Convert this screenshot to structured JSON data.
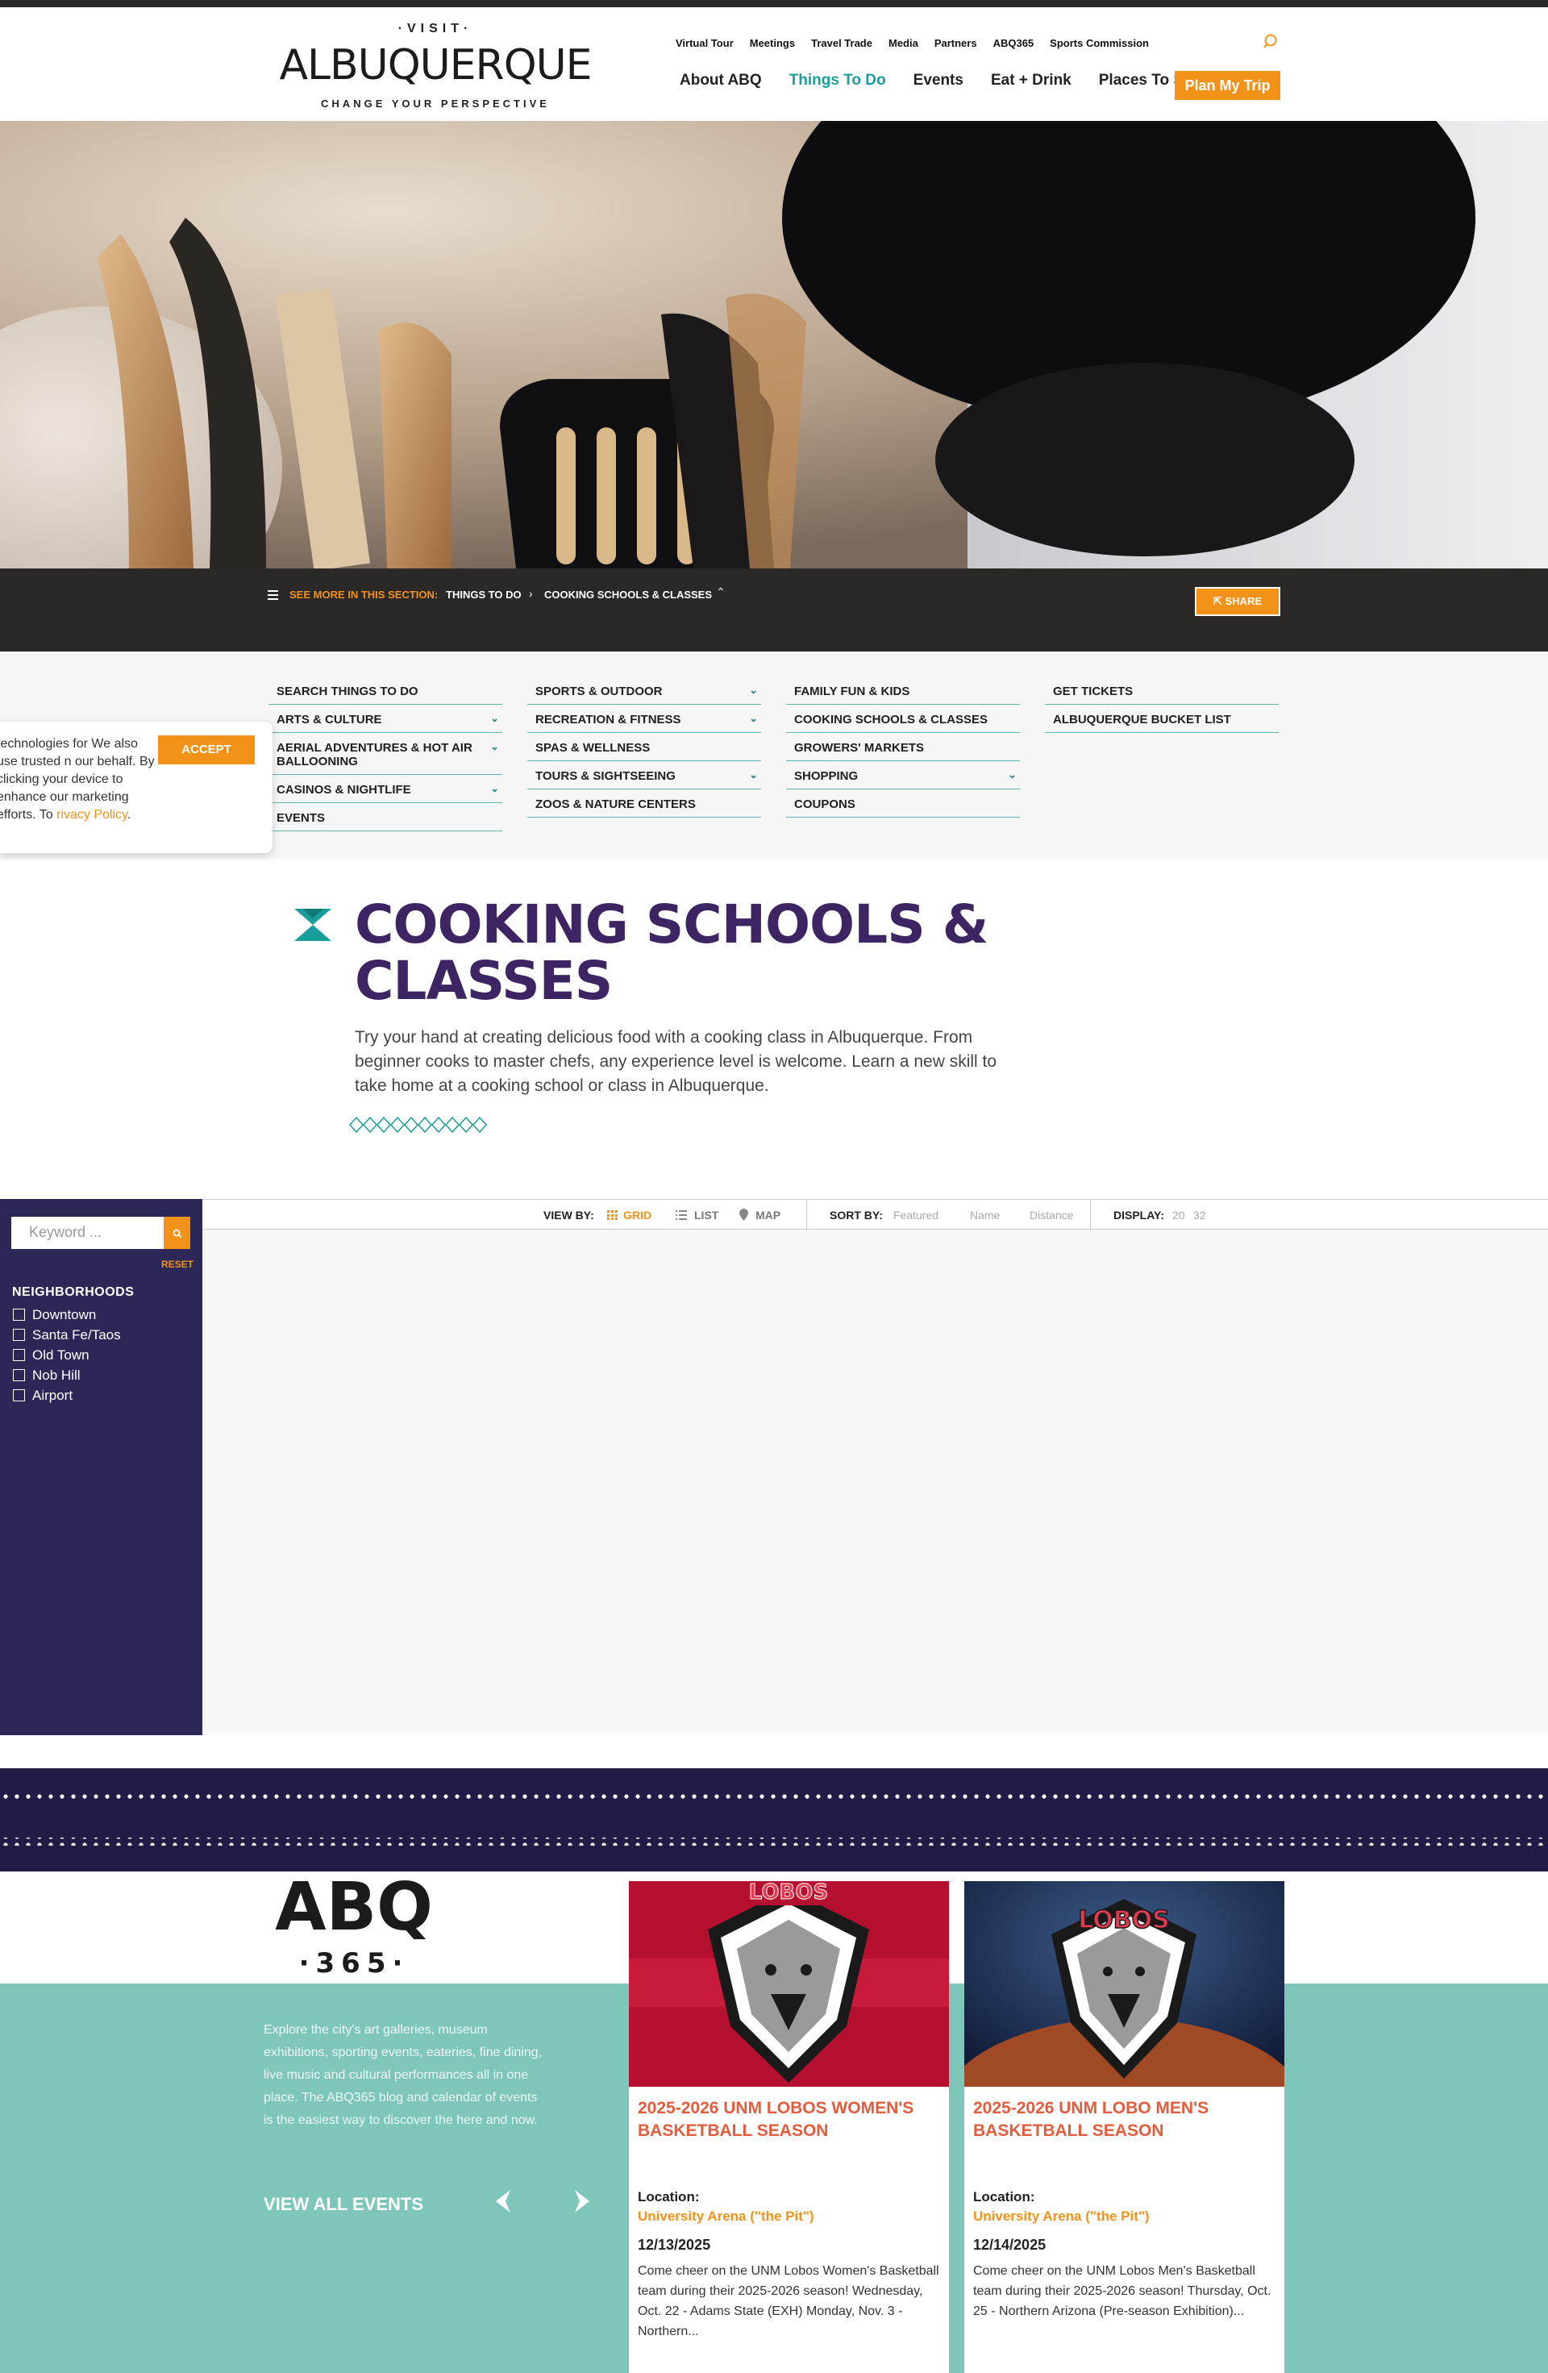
{
  "header": {
    "logo": {
      "visit": "·VISIT·",
      "wordmark": "ALBUQUERQUE",
      "tagline": "CHANGE YOUR PERSPECTIVE"
    },
    "utility_nav": [
      "Virtual Tour",
      "Meetings",
      "Travel Trade",
      "Media",
      "Partners",
      "ABQ365",
      "Sports Commission"
    ],
    "main_nav": [
      "About ABQ",
      "Things To Do",
      "Events",
      "Eat + Drink",
      "Places To Stay"
    ],
    "active_nav": "Things To Do",
    "plan_button": "Plan My Trip"
  },
  "section_bar": {
    "see_more": "SEE MORE IN THIS SECTION:",
    "crumb_parent": "THINGS TO DO",
    "crumb_current": "COOKING SCHOOLS & CLASSES",
    "share": "SHARE"
  },
  "subnav": {
    "col1": [
      {
        "label": "SEARCH THINGS TO DO",
        "expand": false
      },
      {
        "label": "ARTS & CULTURE",
        "expand": true
      },
      {
        "label": "AERIAL ADVENTURES & HOT AIR BALLOONING",
        "expand": true
      },
      {
        "label": "CASINOS & NIGHTLIFE",
        "expand": true
      },
      {
        "label": "EVENTS",
        "expand": false
      }
    ],
    "col2": [
      {
        "label": "SPORTS & OUTDOOR",
        "expand": true
      },
      {
        "label": "RECREATION & FITNESS",
        "expand": true
      },
      {
        "label": "SPAS & WELLNESS",
        "expand": false
      },
      {
        "label": "TOURS & SIGHTSEEING",
        "expand": true
      },
      {
        "label": "ZOOS & NATURE CENTERS",
        "expand": false
      }
    ],
    "col3": [
      {
        "label": "FAMILY FUN & KIDS",
        "expand": false
      },
      {
        "label": "COOKING SCHOOLS & CLASSES",
        "expand": false
      },
      {
        "label": "GROWERS' MARKETS",
        "expand": false
      },
      {
        "label": "SHOPPING",
        "expand": true
      },
      {
        "label": "COUPONS",
        "expand": false
      }
    ],
    "col4": [
      {
        "label": "GET TICKETS",
        "expand": false
      },
      {
        "label": "ALBUQUERQUE BUCKET LIST",
        "expand": false
      }
    ]
  },
  "cookie": {
    "text": "technologies for We also use trusted n our behalf. By clicking your device to enhance our marketing efforts. To",
    "link": "rivacy Policy",
    "after_link": ".",
    "accept": "ACCEPT"
  },
  "page": {
    "title": "COOKING SCHOOLS & CLASSES",
    "intro": "Try your hand at creating delicious food with a cooking class in Albuquerque. From beginner cooks to master chefs, any experience level is welcome. Learn a new skill to take home at a cooking school or class in Albuquerque."
  },
  "filters": {
    "keyword_placeholder": "Keyword ...",
    "reset": "RESET",
    "neighborhoods_title": "NEIGHBORHOODS",
    "neighborhoods": [
      "Downtown",
      "Santa Fe/Taos",
      "Old Town",
      "Nob Hill",
      "Airport"
    ]
  },
  "toolbar": {
    "view_by": "VIEW BY:",
    "grid": "GRID",
    "list": "LIST",
    "map": "MAP",
    "sort_by": "SORT BY:",
    "sort_featured": "Featured",
    "sort_name": "Name",
    "sort_distance": "Distance",
    "display": "DISPLAY:",
    "display_20": "20",
    "display_32": "32"
  },
  "abq365": {
    "logo_top": "ABQ",
    "logo_bottom": "·365·",
    "description": "Explore the city's art galleries, museum exhibitions, sporting events, eateries, fine dining, live music and cultural performances all in one place. The ABQ365 blog and calendar of events is the easiest way to discover the here and now.",
    "view_all": "VIEW ALL EVENTS",
    "cards": [
      {
        "image_text": "LOBOS",
        "title": "2025-2026 UNM LOBOS WOMEN'S BASKETBALL SEASON",
        "location_label": "Location:",
        "location": "University Arena (\"the Pit\")",
        "date": "12/13/2025",
        "description": "Come cheer on the UNM Lobos Women's Basketball team during their 2025-2026 season! Wednesday, Oct. 22 - Adams State (EXH) Monday, Nov. 3 - Northern..."
      },
      {
        "image_text": "LOBOS",
        "title": "2025-2026 UNM LOBO MEN'S BASKETBALL SEASON",
        "location_label": "Location:",
        "location": "University Arena (\"the Pit\")",
        "date": "12/14/2025",
        "description": "Come cheer on the UNM Lobos Men's Basketball team during their 2025-2026 season! Thursday, Oct. 25 - Northern Arizona (Pre-season Exhibition)..."
      }
    ]
  },
  "colors": {
    "accent_orange": "#f29219",
    "teal": "#1a9e9b",
    "purple": "#3d2564",
    "navy": "#2b2756"
  }
}
